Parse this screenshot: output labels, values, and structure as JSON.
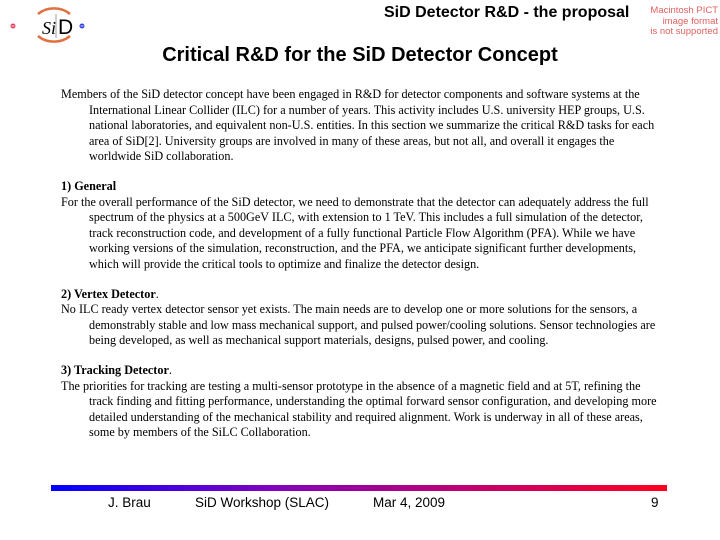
{
  "header": {
    "logo_text_si": "Si",
    "logo_text_d": "D",
    "title": "SiD Detector R&D - the proposal",
    "pict_notice": [
      "Macintosh PICT",
      "image format",
      "is not supported"
    ]
  },
  "slide_title": "Critical R&D for the SiD Detector Concept",
  "intro": "Members of the SiD detector concept have been engaged in R&D for detector components and software systems at the International Linear Collider (ILC) for a number of years. This activity includes U.S. university HEP groups, U.S. national laboratories, and equivalent non-U.S. entities. In this section we summarize the critical R&D tasks for each area of SiD[2]. University groups are involved in many of these areas, but not all, and overall it engages the worldwide SiD collaboration.",
  "sections": [
    {
      "heading": "1) General",
      "heading_suffix": "",
      "body": "For the overall performance of the SiD detector, we need to demonstrate that the detector can adequately address the full spectrum of the physics at a 500GeV ILC, with extension to 1 TeV. This includes a full simulation of the detector, track reconstruction code, and development of a fully functional Particle Flow Algorithm (PFA). While we have working versions of the simulation, reconstruction, and the PFA, we anticipate significant further developments, which will provide the critical tools to optimize and finalize the detector design."
    },
    {
      "heading": "2) Vertex Detector",
      "heading_suffix": ".",
      "body": "No ILC ready vertex detector sensor yet exists. The main needs are to develop one or more solutions for the sensors, a demonstrably stable and low mass mechanical support, and pulsed power/cooling solutions. Sensor technologies are being developed, as well as mechanical support materials, designs, pulsed power, and cooling."
    },
    {
      "heading": "3) Tracking Detector",
      "heading_suffix": ".",
      "body": "The priorities for tracking are testing a multi-sensor prototype in the absence of a magnetic field and at 5T, refining the track finding and fitting performance, understanding the optimal forward sensor configuration, and developing more detailed understanding of the mechanical stability and required alignment. Work is underway in all of these areas, some by members of the SiLC Collaboration."
    }
  ],
  "footer": {
    "author": "J. Brau",
    "event": "SiD Workshop (SLAC)",
    "date": "Mar 4, 2009",
    "page": "9"
  },
  "colors": {
    "gradient_start": "#0000ff",
    "gradient_end": "#ff0020",
    "logo_arc": "#e07040"
  }
}
